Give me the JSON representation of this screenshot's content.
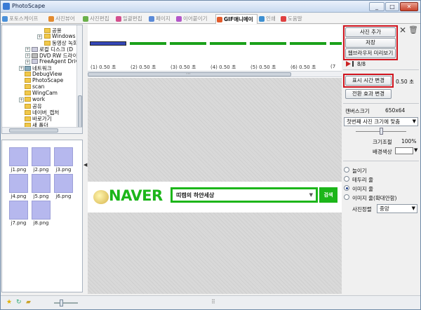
{
  "window": {
    "title": "PhotoScape",
    "min_label": "_",
    "max_label": "□",
    "close_label": "✕"
  },
  "tabs": [
    {
      "label": "포토스케이프",
      "color": "#4a90d9"
    },
    {
      "label": "사진뷰어",
      "color": "#e38b2f"
    },
    {
      "label": "사진편집",
      "color": "#6bb04a"
    },
    {
      "label": "일괄편집",
      "color": "#d44f8e"
    },
    {
      "label": "페이지",
      "color": "#5a8ad8"
    },
    {
      "label": "이어붙이기",
      "color": "#b456c9"
    },
    {
      "label": "GIF애니메이션",
      "color": "#e25b2b"
    },
    {
      "label": "인쇄",
      "color": "#3d8fd1"
    },
    {
      "label": "도움말",
      "color": "#e04040"
    }
  ],
  "tree": [
    {
      "label": "공용"
    },
    {
      "label": "Windows"
    },
    {
      "label": "동영상 녹화"
    },
    {
      "label": "로컬 디스크 (D"
    },
    {
      "label": "DVD RW 드라이"
    },
    {
      "label": "FreeAgent Driv"
    },
    {
      "label": "네트워크"
    },
    {
      "label": "DebugView"
    },
    {
      "label": "PhotoScape"
    },
    {
      "label": "scan"
    },
    {
      "label": "WingCam"
    },
    {
      "label": "work"
    },
    {
      "label": "공유"
    },
    {
      "label": "네이버_캡처"
    },
    {
      "label": "바로가기"
    },
    {
      "label": "새 폴더"
    }
  ],
  "thumbnails": [
    "j1.png",
    "j2.png",
    "j3.png",
    "j4.png",
    "j5.png",
    "j6.png",
    "j7.png",
    "j8.png"
  ],
  "frames": {
    "times": [
      "(1) 0.50 초",
      "(2) 0.50 초",
      "(3) 0.50 초",
      "(4) 0.50 초",
      "(5) 0.50 초",
      "(6) 0.50 초",
      "(7"
    ],
    "grip_glyph": "⋯"
  },
  "preview": {
    "brand": "NAVER",
    "search_text": "띠캠의 하얀세상",
    "search_button": "검색",
    "search_drop": "▼"
  },
  "right_panel": {
    "add_photo": "사진 추가",
    "save": "저장",
    "web_preview": "웹브라우저 미리보기",
    "frame_counter": "8/8",
    "change_time": "표시 시간 변경",
    "time_value": "0.50 초",
    "transition": "전환 효과 변경",
    "canvas_size_label": "캔버스크기",
    "canvas_size_value": "650x64",
    "fit_option": "첫번째 사진 크기에 맞춤",
    "size_adjust_label": "크기조절",
    "size_adjust_value": "100%",
    "bg_color_label": "배경색상",
    "bg_color": "#ffffff",
    "radios": [
      {
        "label": "늘이기",
        "selected": false
      },
      {
        "label": "테두리 줄",
        "selected": false
      },
      {
        "label": "이미지 줄",
        "selected": true
      },
      {
        "label": "이미지 줄(확대안함)",
        "selected": false
      }
    ],
    "align_label": "사진정렬",
    "align_value": "중앙"
  },
  "accent": {
    "highlight": "#d0141e",
    "naver_green": "#1cb61a"
  }
}
